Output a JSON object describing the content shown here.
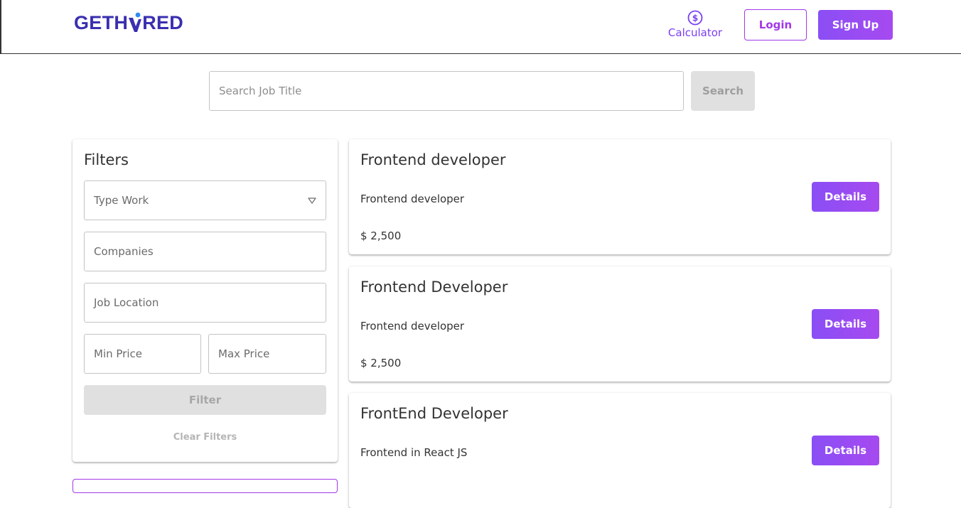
{
  "header": {
    "logo_text_left": "GETH",
    "logo_text_right": "RED",
    "calculator_label": "Calculator",
    "calculator_icon": "dollar-circle-icon",
    "login_label": "Login",
    "signup_label": "Sign Up"
  },
  "search": {
    "placeholder": "Search Job Title",
    "button_label": "Search"
  },
  "filters": {
    "title": "Filters",
    "type_work_label": "Type Work",
    "companies_label": "Companies",
    "location_label": "Job Location",
    "min_price_label": "Min Price",
    "max_price_label": "Max Price",
    "filter_button": "Filter",
    "clear_label": "Clear Filters"
  },
  "jobs": [
    {
      "title": "Frontend developer",
      "description": "Frontend developer",
      "price": "$ 2,500",
      "button": "Details"
    },
    {
      "title": "Frontend Developer",
      "description": "Frontend developer",
      "price": "$ 2,500",
      "button": "Details"
    },
    {
      "title": "FrontEnd Developer",
      "description": "Frontend in React JS",
      "price": "",
      "button": "Details"
    }
  ],
  "colors": {
    "accent": "#8a4ef5",
    "accent_secondary": "#a238e8",
    "logo": "#3a2fb0",
    "disabled_bg": "#e0e0e0"
  }
}
